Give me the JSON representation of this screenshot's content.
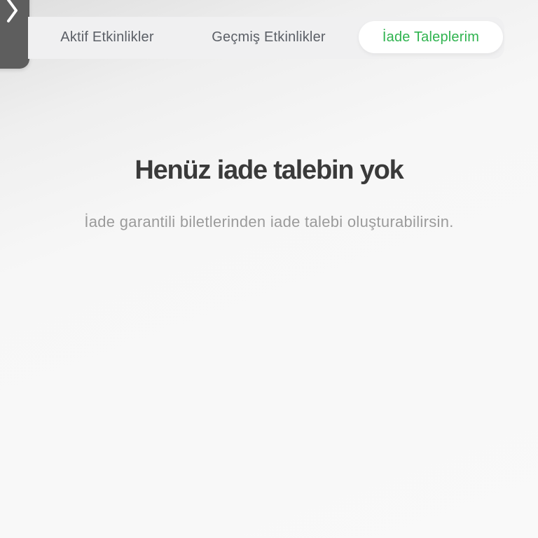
{
  "tabs": [
    {
      "label": "Aktif Etkinlikler",
      "active": false
    },
    {
      "label": "Geçmiş Etkinlikler",
      "active": false
    },
    {
      "label": "İade Taleplerim",
      "active": true
    }
  ],
  "empty_state": {
    "title": "Henüz iade talebin yok",
    "subtitle": "İade garantili biletlerinden iade talebi oluşturabilirsin."
  },
  "colors": {
    "accent": "#2fb34f",
    "tab_text": "#5b5f66",
    "title_text": "#3a3a3a",
    "subtitle_text": "#9b9b9b",
    "handle": "#5e5e5e"
  },
  "icons": {
    "side_handle": "chevron-right-icon"
  }
}
